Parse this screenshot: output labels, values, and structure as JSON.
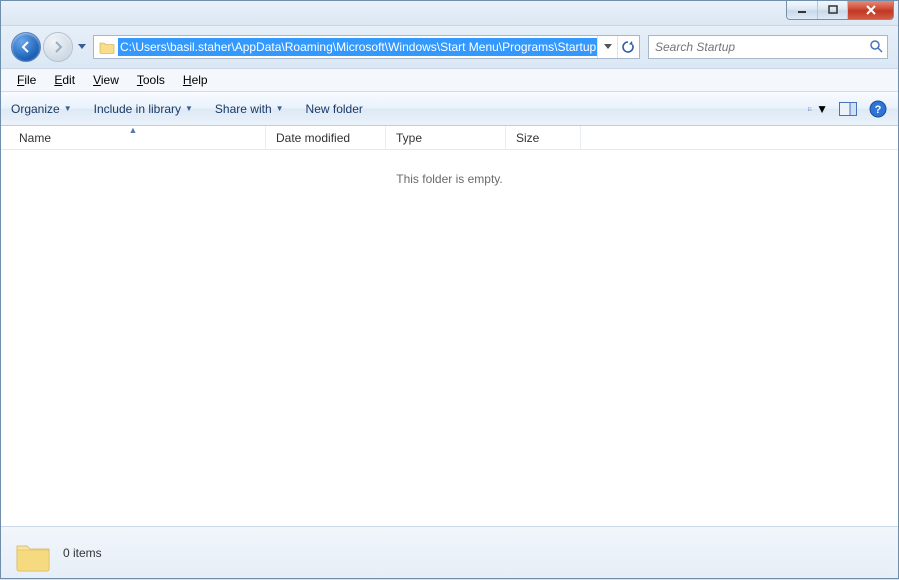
{
  "window": {
    "title": ""
  },
  "nav": {
    "path": "C:\\Users\\basil.staher\\AppData\\Roaming\\Microsoft\\Windows\\Start Menu\\Programs\\Startup",
    "search_placeholder": "Search Startup"
  },
  "menubar": {
    "file": "File",
    "edit": "Edit",
    "view": "View",
    "tools": "Tools",
    "help": "Help"
  },
  "toolbar": {
    "organize": "Organize",
    "include": "Include in library",
    "share": "Share with",
    "newfolder": "New folder"
  },
  "columns": {
    "name": "Name",
    "date": "Date modified",
    "type": "Type",
    "size": "Size"
  },
  "content": {
    "empty_message": "This folder is empty."
  },
  "status": {
    "items": "0 items"
  }
}
